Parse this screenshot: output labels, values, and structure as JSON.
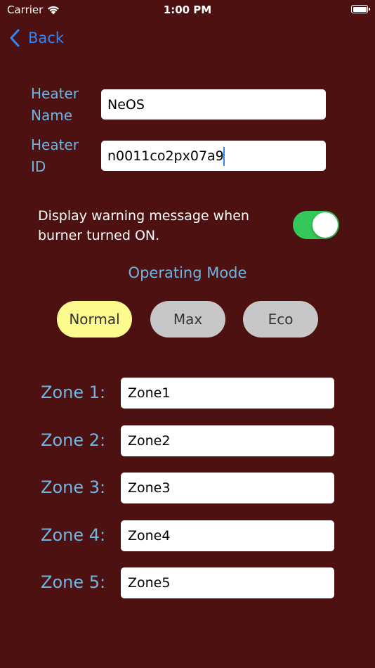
{
  "status_bar": {
    "carrier": "Carrier",
    "time": "1:00 PM",
    "wifi_icon": "wifi-icon",
    "battery_icon": "battery-icon"
  },
  "nav": {
    "back_label": "Back",
    "back_icon": "chevron-left-icon",
    "accent_color": "#2f86f6"
  },
  "heater": {
    "name_label_line1": "Heater",
    "name_label_line2": "Name",
    "name_value": "NeOS",
    "id_label_line1": "Heater",
    "id_label_line2": "ID",
    "id_value": "n0011co2px07a9"
  },
  "warning": {
    "text": "Display warning message when burner turned ON.",
    "toggle_on": true,
    "toggle_color": "#34c759"
  },
  "operating_mode": {
    "title": "Operating Mode",
    "options": [
      {
        "label": "Normal",
        "selected": true,
        "color": "#fdfb8d"
      },
      {
        "label": "Max",
        "selected": false,
        "color": "#c7c7c7"
      },
      {
        "label": "Eco",
        "selected": false,
        "color": "#c7c7c7"
      }
    ]
  },
  "zones": [
    {
      "label": "Zone 1:",
      "value": "Zone1"
    },
    {
      "label": "Zone 2:",
      "value": "Zone2"
    },
    {
      "label": "Zone 3:",
      "value": "Zone3"
    },
    {
      "label": "Zone 4:",
      "value": "Zone4"
    },
    {
      "label": "Zone 5:",
      "value": "Zone5"
    }
  ],
  "colors": {
    "background": "#4e1111",
    "label": "#6cb6e4"
  }
}
